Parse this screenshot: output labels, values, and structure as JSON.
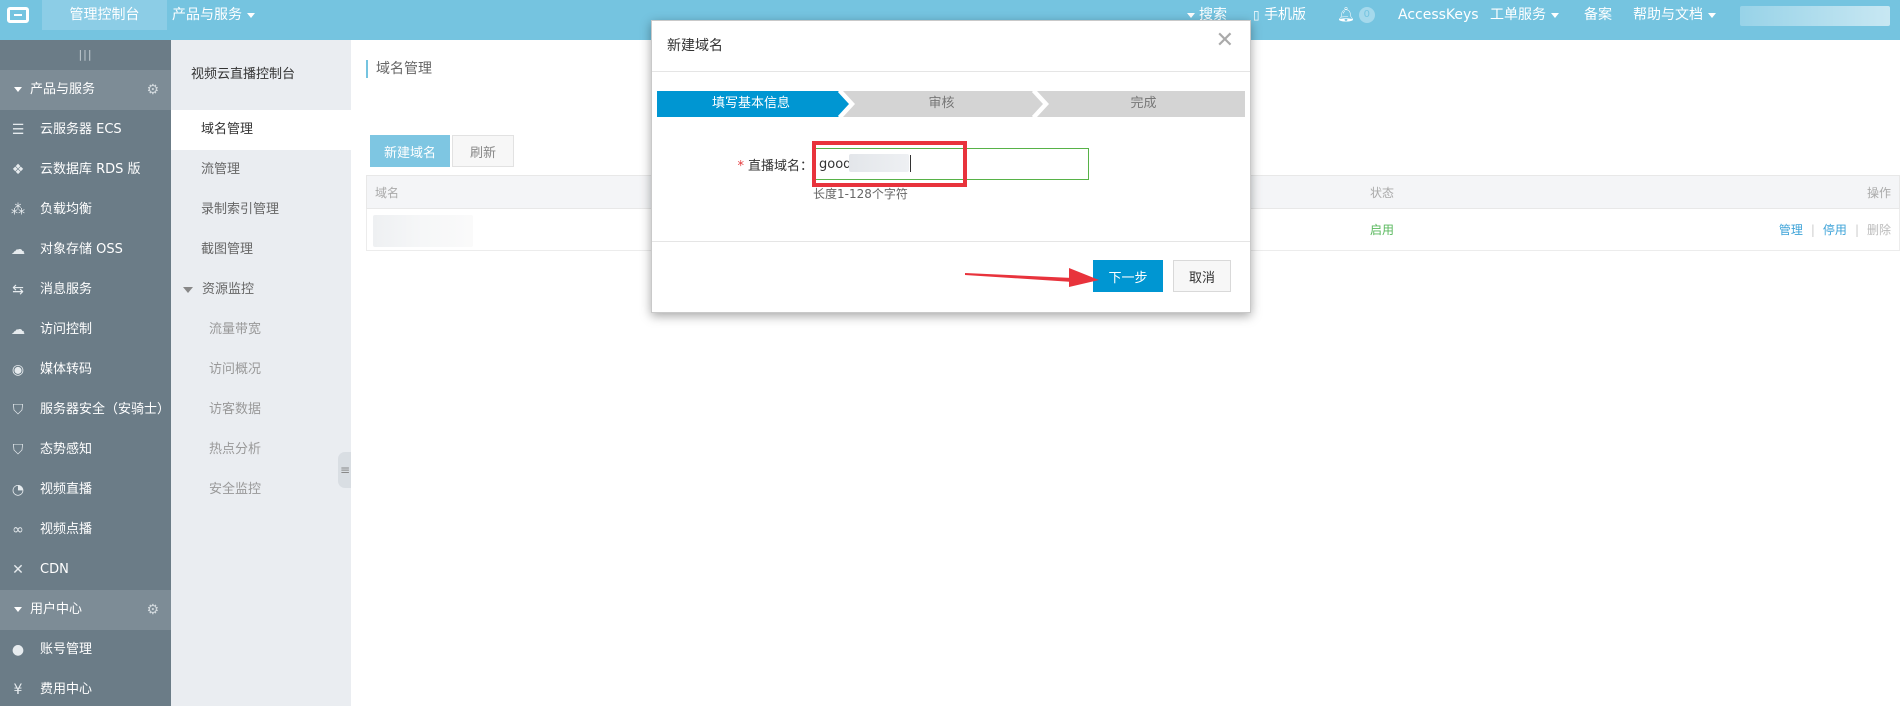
{
  "topbar": {
    "title": "管理控制台",
    "products_label": "产品与服务",
    "search_label": "搜索",
    "mobile_label": "手机版",
    "notification_count": "0",
    "accesskeys_label": "AccessKeys",
    "ticket_label": "工单服务",
    "beian_label": "备案",
    "help_label": "帮助与文档"
  },
  "leftnav": {
    "handle": "|||",
    "group_products": "产品与服务",
    "items": [
      {
        "label": "云服务器 ECS",
        "icon": "server-icon"
      },
      {
        "label": "云数据库 RDS 版",
        "icon": "database-icon"
      },
      {
        "label": "负载均衡",
        "icon": "load-balancer-icon"
      },
      {
        "label": "对象存储 OSS",
        "icon": "cloud-storage-icon"
      },
      {
        "label": "消息服务",
        "icon": "message-icon"
      },
      {
        "label": "访问控制",
        "icon": "access-control-icon"
      },
      {
        "label": "媒体转码",
        "icon": "media-icon"
      },
      {
        "label": "服务器安全（安骑士）",
        "icon": "shield-icon"
      },
      {
        "label": "态势感知",
        "icon": "situation-icon"
      },
      {
        "label": "视频直播",
        "icon": "live-video-icon"
      },
      {
        "label": "视频点播",
        "icon": "vod-icon"
      },
      {
        "label": "CDN",
        "icon": "cdn-icon"
      }
    ],
    "group_user": "用户中心",
    "user_items": [
      {
        "label": "账号管理",
        "icon": "user-icon"
      },
      {
        "label": "费用中心",
        "icon": "yen-icon"
      }
    ]
  },
  "subnav": {
    "title": "视频云直播控制台",
    "items": [
      "域名管理",
      "流管理",
      "录制索引管理",
      "截图管理"
    ],
    "group": "资源监控",
    "children": [
      "流量带宽",
      "访问概况",
      "访客数据",
      "热点分析",
      "安全监控"
    ]
  },
  "main": {
    "breadcrumb": "域名管理",
    "new_button": "新建域名",
    "refresh_button": "刷新",
    "table": {
      "col_domain": "域名",
      "col_status": "状态",
      "col_actions": "操作",
      "row_status": "启用",
      "action_manage": "管理",
      "action_disable": "停用",
      "action_delete": "删除"
    }
  },
  "modal": {
    "title": "新建域名",
    "close_glyph": "✕",
    "steps": [
      "填写基本信息",
      "审核",
      "完成"
    ],
    "field_label": "直播域名：",
    "field_value": "good.",
    "hint": "长度1-128个字符",
    "next_button": "下一步",
    "cancel_button": "取消"
  },
  "colors": {
    "topbar": "#75c4e0",
    "leftnav": "#6b7c87",
    "step_active": "#0096d2",
    "step_inactive": "#d4d4d4",
    "annotation": "#e8333c",
    "status_on": "#59b85d"
  }
}
